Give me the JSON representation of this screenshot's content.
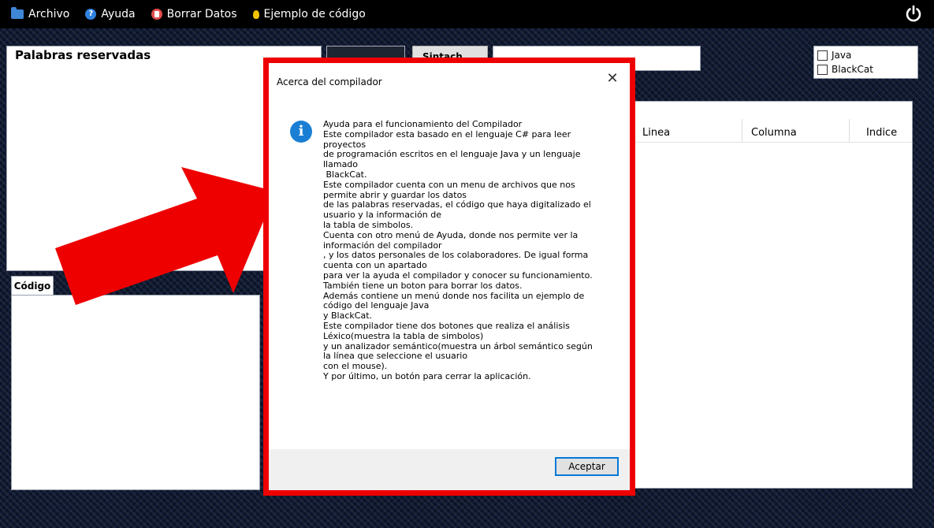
{
  "menu": {
    "items": [
      {
        "label": "Archivo",
        "icon": "folder-icon"
      },
      {
        "label": "Ayuda",
        "icon": "help-icon"
      },
      {
        "label": "Borrar Datos",
        "icon": "trash-icon"
      },
      {
        "label": "Ejemplo de código",
        "icon": "bulb-icon"
      }
    ],
    "power_icon": "power-icon"
  },
  "panels": {
    "reserved_title": "Palabras reservadas",
    "code_tab": "Código",
    "partial_button_label": "Sintach"
  },
  "checks": [
    {
      "label": "Java",
      "checked": false
    },
    {
      "label": "BlackCat",
      "checked": false
    }
  ],
  "table": {
    "columns": [
      "Linea",
      "Columna",
      "Indice"
    ]
  },
  "dialog": {
    "title": "Acerca del compilador",
    "close": "✕",
    "body": "Ayuda para el funcionamiento del Compilador\nEste compilador esta basado en el lenguaje C# para leer\nproyectos\nde programación escritos en el lenguaje Java y un lenguaje\nllamado\n BlackCat.\nEste compilador cuenta con un menu de archivos que nos\npermite abrir y guardar los datos\nde las palabras reservadas, el código que haya digitalizado el\nusuario y la información de\nla tabla de simbolos.\nCuenta con otro menú de Ayuda, donde nos permite ver la\ninformación del compilador\n, y los datos personales de los colaboradores. De igual forma\ncuenta con un apartado\npara ver la ayuda el compilador y conocer su funcionamiento.\nTambién tiene un boton para borrar los datos.\nAdemás contiene un menú donde nos facilita un ejemplo de\ncódigo del lenguaje Java\ny BlackCat.\nEste compilador tiene dos botones que realiza el análisis\nLéxico(muestra la tabla de simbolos)\ny un analizador semántico(muestra un árbol semántico según\nla línea que seleccione el usuario\ncon el mouse).\nY por último, un botón para cerrar la aplicación.",
    "ok_label": "Aceptar"
  },
  "colors": {
    "highlight": "#ee0000",
    "info_blue": "#1a7fd4"
  }
}
